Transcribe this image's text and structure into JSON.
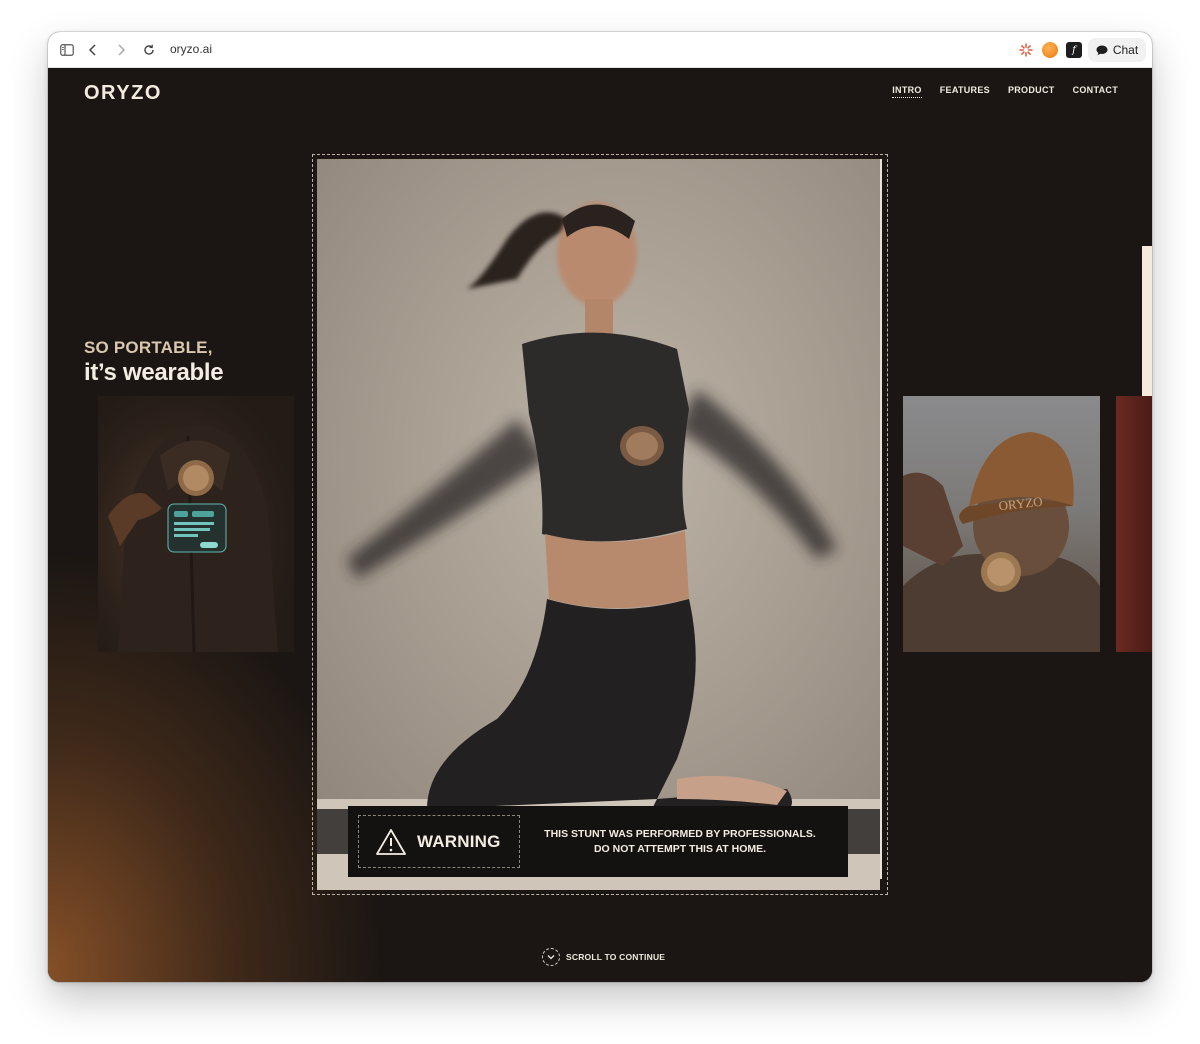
{
  "browser": {
    "url": "oryzo.ai",
    "chat_label": "Chat",
    "icons": [
      "sidebar-toggle-icon",
      "back-arrow-icon",
      "forward-arrow-icon",
      "reload-icon",
      "sun-extension-icon",
      "orange-circle-extension-icon",
      "f-extension-icon",
      "chat-bubble-icon"
    ]
  },
  "site": {
    "logo": "ORYZO",
    "nav": [
      {
        "label": "INTRO",
        "active": true
      },
      {
        "label": "FEATURES",
        "active": false
      },
      {
        "label": "PRODUCT",
        "active": false
      },
      {
        "label": "CONTACT",
        "active": false
      }
    ],
    "headline": {
      "line1": "SO PORTABLE,",
      "line2": "it’s wearable"
    },
    "warning": {
      "title": "WARNING",
      "line1": "THIS STUNT WAS PERFORMED BY PROFESSIONALS.",
      "line2": "DO NOT ATTEMPT THIS AT HOME."
    },
    "scroll_cta": "SCROLL TO CONTINUE",
    "cap_text": "ORYZO",
    "colors": {
      "background": "#1b1613",
      "accent_glow": "#8a5228",
      "text": "#f4ede4",
      "headline_muted": "#d9c7ae"
    }
  }
}
